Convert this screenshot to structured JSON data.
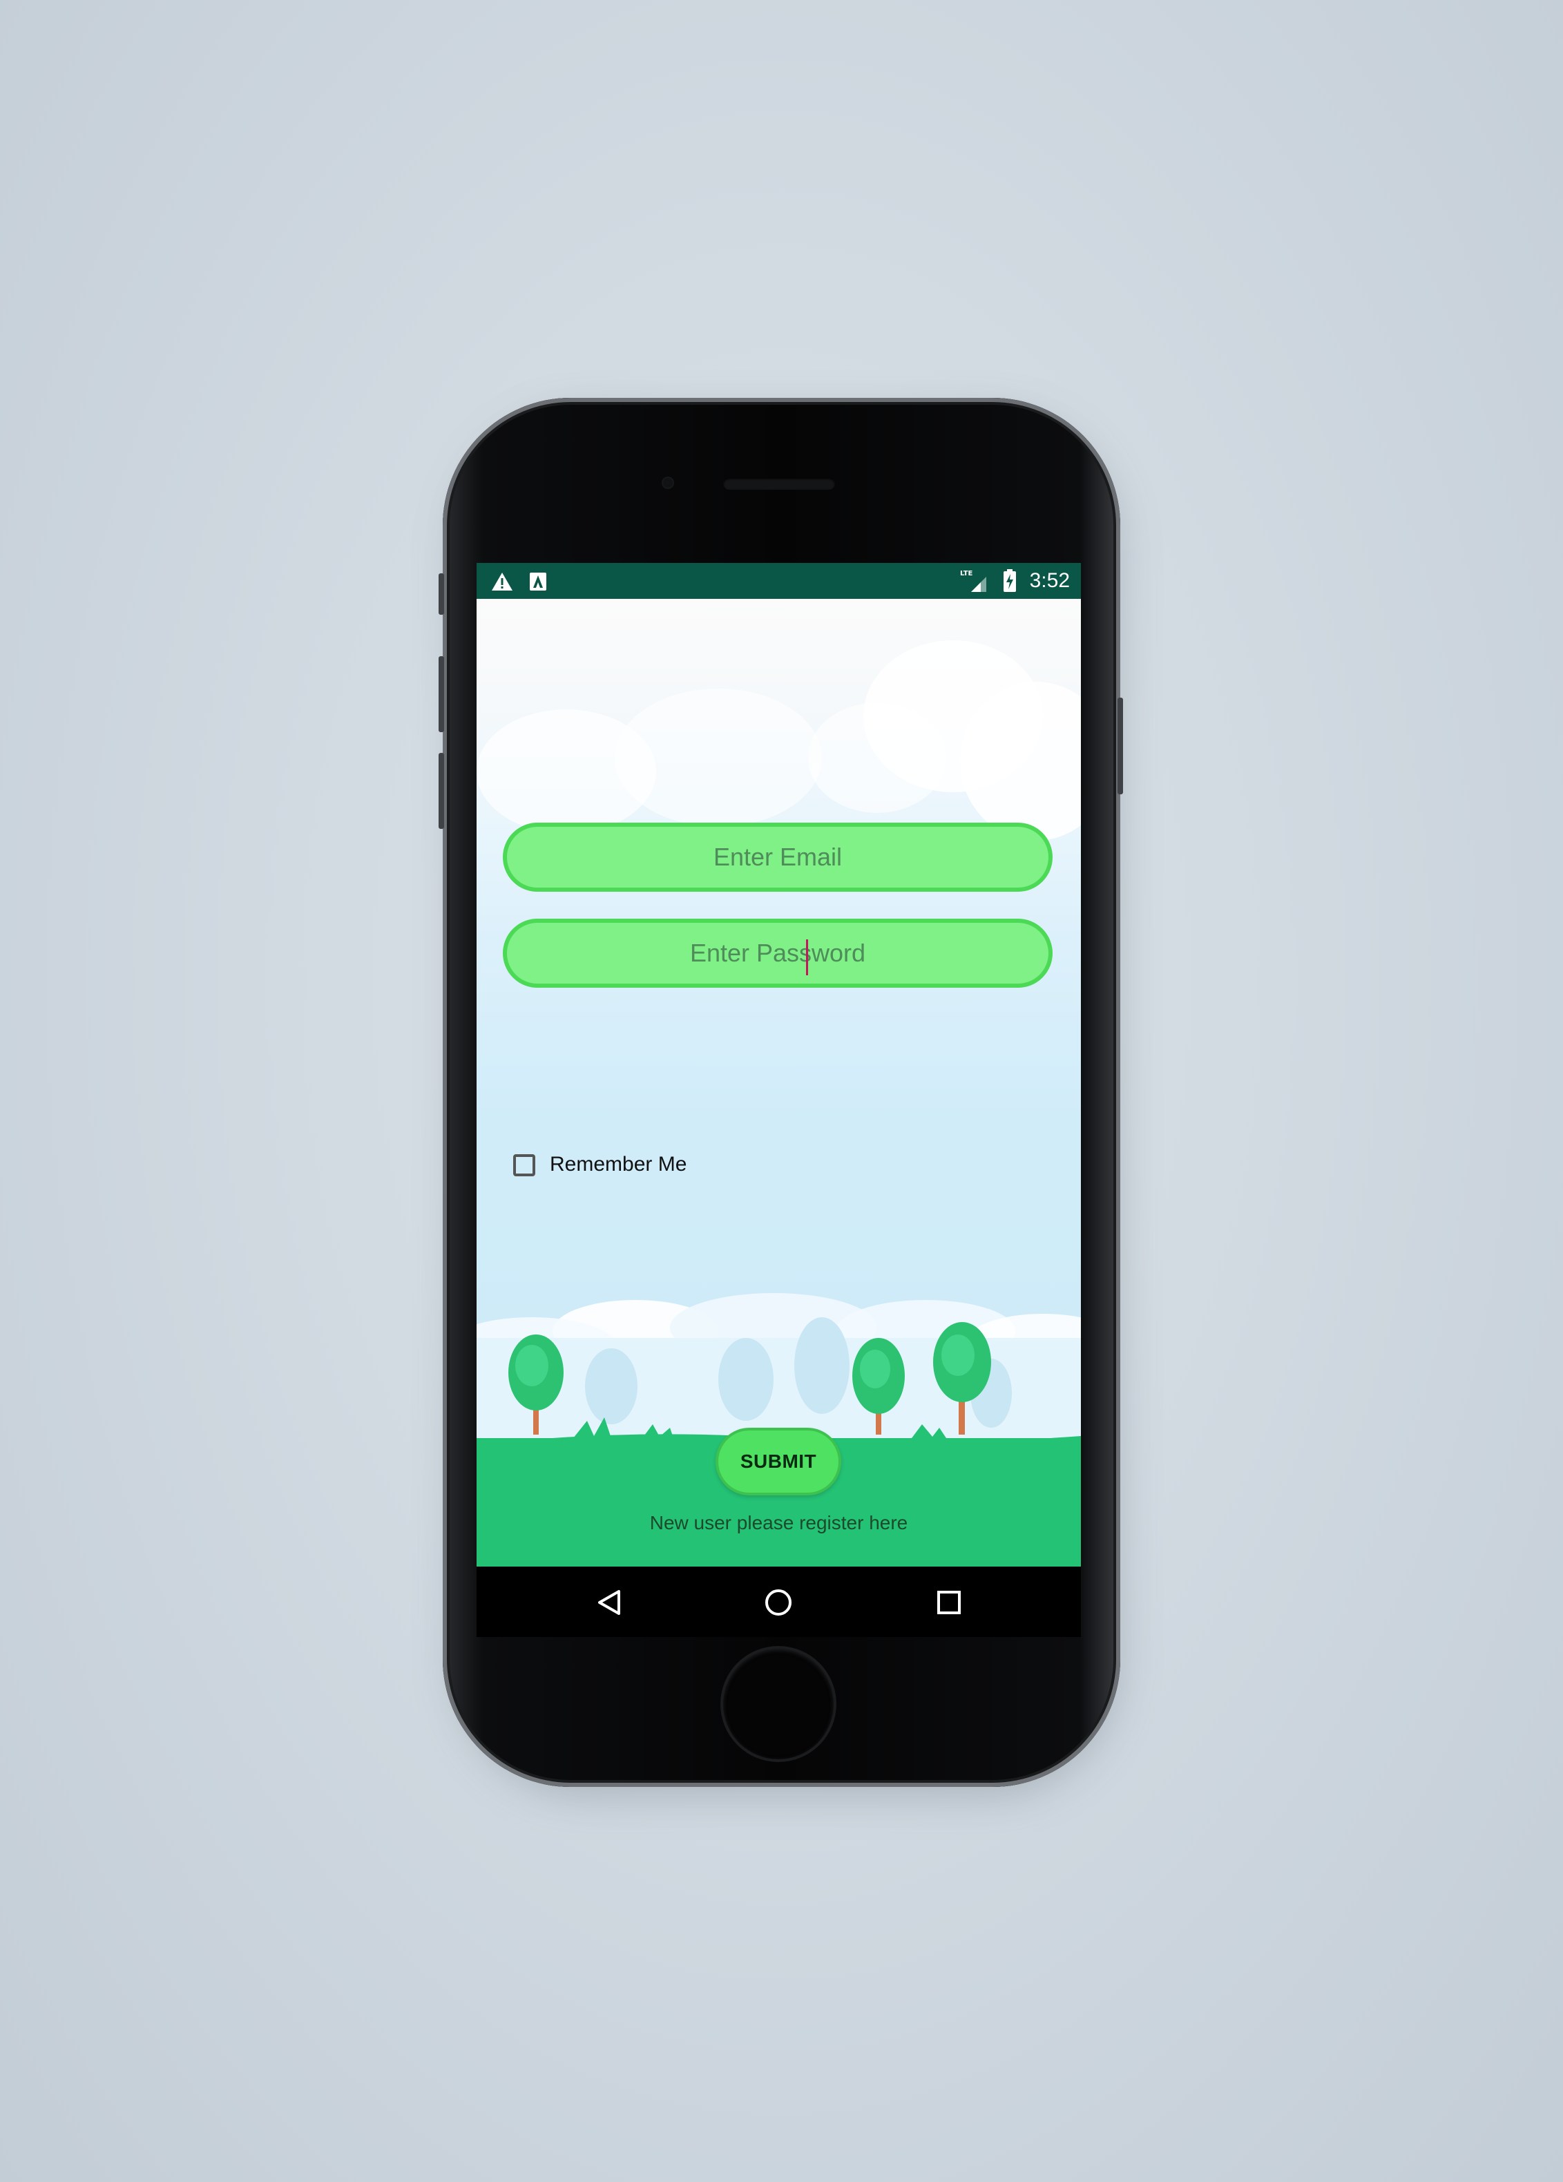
{
  "status_bar": {
    "time": "3:52",
    "icons": [
      "warning-icon",
      "a-notification-icon",
      "lte-signal-icon",
      "battery-charging-icon"
    ]
  },
  "login": {
    "email_placeholder": "Enter Email",
    "password_placeholder": "Enter Password",
    "remember_label": "Remember Me",
    "remember_checked": false,
    "submit_label": "SUBMIT",
    "register_text": "New user please register here"
  },
  "nav_bar": {
    "buttons": [
      "back-icon",
      "home-icon",
      "recents-icon"
    ]
  },
  "colors": {
    "status_bar": "#0a5747",
    "field_fill": "#80f187",
    "field_border": "#4cd956",
    "ground": "#24c275",
    "submit": "#4fe162"
  }
}
